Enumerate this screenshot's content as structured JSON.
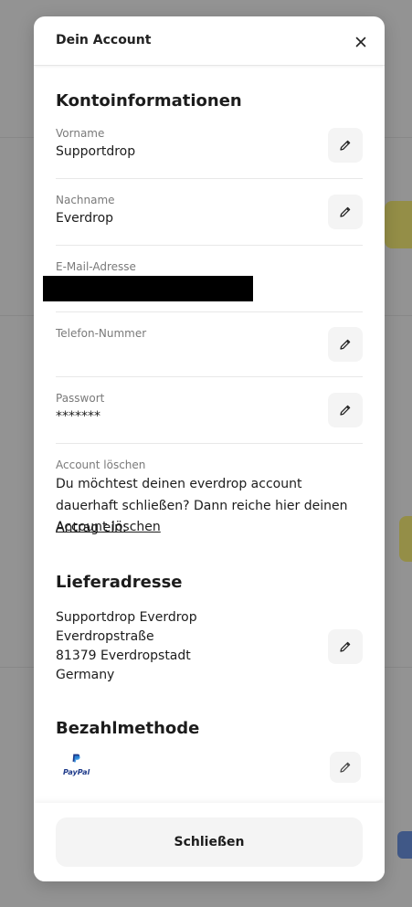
{
  "modal": {
    "title": "Dein Account",
    "close_footer_label": "Schließen"
  },
  "kontoinformationen": {
    "title": "Kontoinformationen",
    "vorname": {
      "label": "Vorname",
      "value": "Supportdrop"
    },
    "nachname": {
      "label": "Nachname",
      "value": "Everdrop"
    },
    "email": {
      "label": "E-Mail-Adresse",
      "value": ""
    },
    "telefon": {
      "label": "Telefon-Nummer",
      "value": ""
    },
    "passwort": {
      "label": "Passwort",
      "value": "*******"
    },
    "account_loeschen": {
      "label": "Account löschen",
      "text": "Du möchtest deinen everdrop account dauerhaft schließen? Dann reiche hier deinen Antrag ein:",
      "link": "Account löschen"
    }
  },
  "lieferadresse": {
    "title": "Lieferadresse",
    "lines": [
      "Supportdrop Everdrop",
      "Everdropstraße",
      "81379 Everdropstadt",
      "Germany"
    ]
  },
  "bezahlmethode": {
    "title": "Bezahlmethode",
    "method_icon": "paypal-logo",
    "method_text": "PayPal"
  },
  "colors": {
    "background_dim": "#8a8a8a",
    "button_bg": "#f4f4f4",
    "text": "#1c1c1c",
    "label": "#7a7a7a",
    "paypal_blue": "#1e3a8a"
  }
}
